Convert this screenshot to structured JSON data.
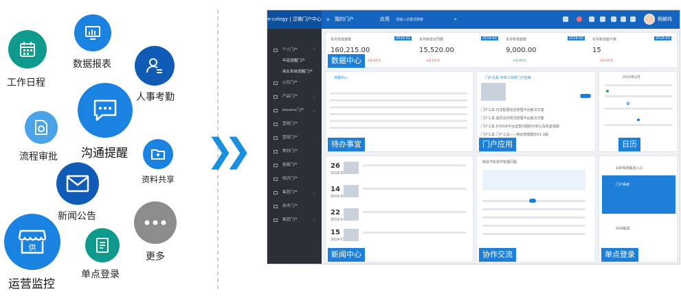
{
  "features": {
    "work_calendar": "工作日程",
    "data_report": "数据报表",
    "hr_attendance": "人事考勤",
    "communication": "沟通提醒",
    "workflow": "流程审批",
    "file_share": "资料共享",
    "news": "新闻公告",
    "more": "更多",
    "operations": "运营监控",
    "sso": "单点登录"
  },
  "colors": {
    "teal": "#0e9a8c",
    "blue": "#1a82e0",
    "darkblue": "#0f5bb5",
    "gray": "#8c8c8c",
    "lightblue": "#4aa3e8"
  },
  "shot": {
    "brand": "e-cology | 泛微门户中心",
    "nav_home": "我的门户",
    "nav_app": "应用",
    "search_placeholder": "请输入关键词搜索",
    "user": "杨朝伟",
    "sidebar": {
      "items": [
        "个人门户",
        "公司门户",
        "产品门户",
        "eteams门户",
        "营销门户",
        "营销门户",
        "策划门户",
        "客服门户",
        "知识门户",
        "集团门户",
        "技术门户",
        "集团门户"
      ],
      "subs": [
        "年底提醒门户",
        "商业系统提醒门户"
      ]
    },
    "stats": [
      {
        "label": "本月完成金额",
        "badge": "2019-02",
        "value": "160,215.00",
        "change": "+0.01%"
      },
      {
        "label": "本月新增合同额",
        "badge": "2019-02",
        "value": "15,520.00",
        "change": "+0.01%"
      },
      {
        "label": "本月新增金额",
        "badge": "2019-02",
        "value": "9,000.00",
        "change": "+0.01%"
      },
      {
        "label": "本月新增客户数",
        "badge": "2019-02",
        "value": "15",
        "change": "+0.01%"
      }
    ],
    "tags": {
      "data_center": "数据中心",
      "todo": "待办事宜",
      "portal_app": "门户应用",
      "calendar": "日历",
      "news_center": "新闻中心",
      "collab": "协作交流",
      "sso": "单点登录"
    },
    "todo_title": "流程中心",
    "portal_title": "门户工具·今年三月热门户应用",
    "portal_items": [
      "门户工具·日志配置信息管理平台解决方案",
      "门户工具·首页访问情况管理平台解决方案",
      "门户工具·针对OA平台运营问题的分析以及改善措施",
      "门户工具·门户工具——移动管理模块V1.0版"
    ],
    "calendar_month": "2019年2月",
    "news_dates": [
      {
        "day": "26",
        "ym": "2019-02"
      },
      {
        "day": "14",
        "ym": "2019-02"
      },
      {
        "day": "22",
        "ym": "2019-01"
      },
      {
        "day": "15",
        "ym": "2019-01"
      }
    ],
    "collab_title": "制造汽车零件管理问题",
    "sso_items": [
      "SAP系统集成入口",
      "门户系统",
      "SOA集成"
    ]
  }
}
